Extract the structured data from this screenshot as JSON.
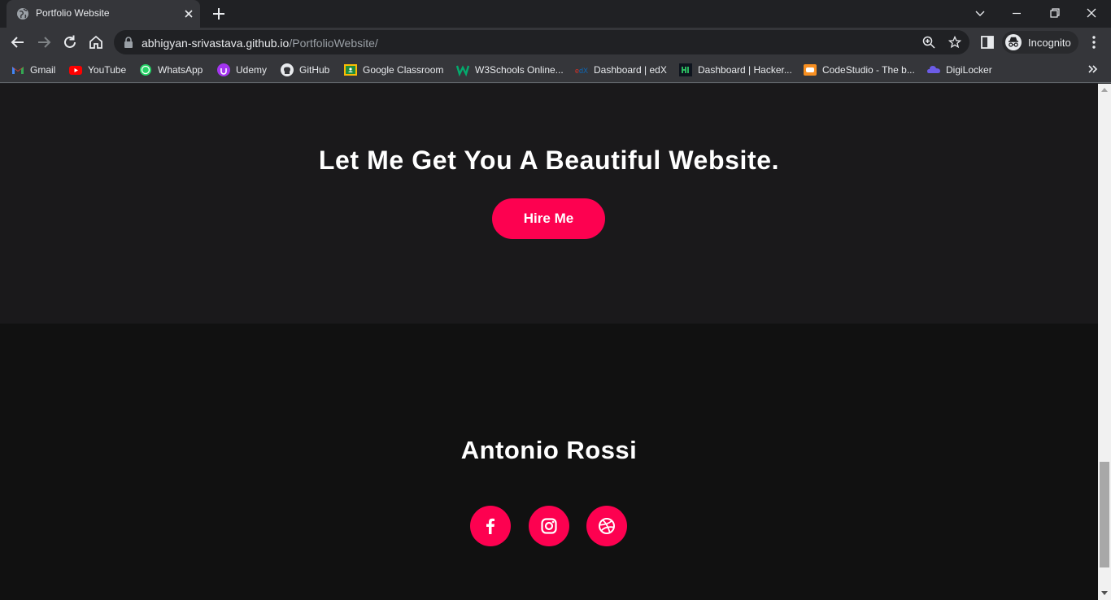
{
  "browser": {
    "tab": {
      "title": "Portfolio Website"
    },
    "address": {
      "host": "abhigyan-srivastava.github.io",
      "path": "/PortfolioWebsite/"
    },
    "profile_label": "Incognito",
    "bookmarks": [
      {
        "label": "Gmail",
        "icon": "gmail-icon"
      },
      {
        "label": "YouTube",
        "icon": "youtube-icon"
      },
      {
        "label": "WhatsApp",
        "icon": "whatsapp-icon"
      },
      {
        "label": "Udemy",
        "icon": "udemy-icon"
      },
      {
        "label": "GitHub",
        "icon": "github-icon"
      },
      {
        "label": "Google Classroom",
        "icon": "classroom-icon"
      },
      {
        "label": "W3Schools Online...",
        "icon": "w3schools-icon"
      },
      {
        "label": "Dashboard | edX",
        "icon": "edx-icon"
      },
      {
        "label": "Dashboard | Hacker...",
        "icon": "hackerrank-icon"
      },
      {
        "label": "CodeStudio - The b...",
        "icon": "codestudio-icon"
      },
      {
        "label": "DigiLocker",
        "icon": "digilocker-icon"
      }
    ]
  },
  "page": {
    "hire": {
      "heading": "Let Me Get You A Beautiful Website.",
      "button_label": "Hire Me"
    },
    "footer": {
      "name": "Antonio Rossi",
      "social": [
        "facebook-icon",
        "instagram-icon",
        "dribbble-icon"
      ]
    }
  },
  "colors": {
    "accent": "#fd0150",
    "section_bg": "#1a191b",
    "footer_bg": "#111111"
  }
}
